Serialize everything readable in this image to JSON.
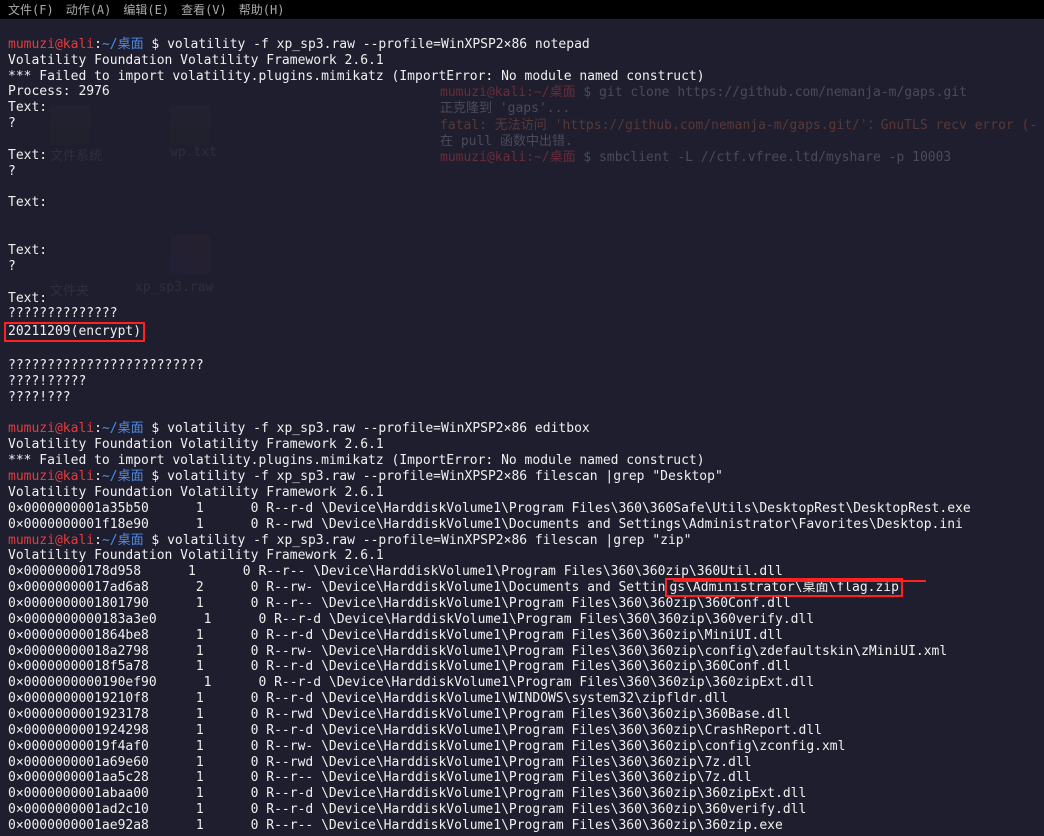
{
  "menu": {
    "items": [
      "文件(F)",
      "动作(A)",
      "编辑(E)",
      "查看(V)",
      "帮助(H)"
    ]
  },
  "background": {
    "lines": [
      {
        "prompt": "mumuzi@kali:~/桌面",
        "cmd": "$ git clone https://github.com/nemanja-m/gaps.git"
      },
      {
        "text": "正克隆到 'gaps'..."
      },
      {
        "text": "fatal: 无法访问 'https://github.com/nemanja-m/gaps.git/'：GnuTLS recv error (-"
      },
      {
        "text": "在 pull 函数中出错."
      },
      {
        "prompt": "mumuzi@kali:~/桌面",
        "cmd": "$ smbclient -L //ctf.vfree.ltd/myshare -p 10003"
      }
    ],
    "icons": [
      {
        "label": "文件系统"
      },
      {
        "label": "wp.txt"
      },
      {
        "label": ""
      },
      {
        "label": "文件夹"
      },
      {
        "label": "xp_sp3.raw"
      }
    ]
  },
  "terminal": {
    "blocks": [
      {
        "prompt": {
          "user": "mumuzi",
          "host": "kali",
          "path": "~/桌面",
          "dollar": "$"
        },
        "command": "volatility -f xp_sp3.raw --profile=WinXPSP2×86 notepad",
        "output": [
          "Volatility Foundation Volatility Framework 2.6.1",
          "*** Failed to import volatility.plugins.mimikatz (ImportError: No module named construct)",
          "Process: 2976",
          "Text:",
          "?",
          "",
          "Text:",
          "?",
          "",
          "Text:",
          "",
          "",
          "Text:",
          "?",
          "",
          "Text:",
          "??????????????",
          "",
          "?????????????????????????",
          "????!?????",
          "????!???",
          ""
        ],
        "highlight": {
          "line_index": 17,
          "text": "20211209(encrypt)"
        }
      },
      {
        "prompt": {
          "user": "mumuzi",
          "host": "kali",
          "path": "~/桌面",
          "dollar": "$"
        },
        "command": "volatility -f xp_sp3.raw --profile=WinXPSP2×86 editbox",
        "output": [
          "Volatility Foundation Volatility Framework 2.6.1",
          "*** Failed to import volatility.plugins.mimikatz (ImportError: No module named construct)"
        ]
      },
      {
        "prompt": {
          "user": "mumuzi",
          "host": "kali",
          "path": "~/桌面",
          "dollar": "$"
        },
        "command": "volatility -f xp_sp3.raw --profile=WinXPSP2×86 filescan |grep \"Desktop\"",
        "output": [
          "Volatility Foundation Volatility Framework 2.6.1",
          "0×0000000001a35b50      1      0 R--r-d \\Device\\HarddiskVolume1\\Program Files\\360\\360Safe\\Utils\\DesktopRest\\DesktopRest.exe",
          "0×0000000001f18e90      1      0 R--rwd \\Device\\HarddiskVolume1\\Documents and Settings\\Administrator\\Favorites\\Desktop.ini"
        ]
      },
      {
        "prompt": {
          "user": "mumuzi",
          "host": "kali",
          "path": "~/桌面",
          "dollar": "$"
        },
        "command": "volatility -f xp_sp3.raw --profile=WinXPSP2×86 filescan |grep \"zip\"",
        "output": [
          "Volatility Foundation Volatility Framework 2.6.1",
          "0×00000000178d958      1      0 R--r-- \\Device\\HarddiskVolume1\\Program Files\\360\\360zip\\360Util.dll",
          "0×00000000017ad6a8      2      0 R--rw- \\Device\\HarddiskVolume1\\Documents and Settings\\Administrator\\桌面\\flag.zip",
          "0×0000000001801790      1      0 R--r-- \\Device\\HarddiskVolume1\\Program Files\\360\\360zip\\360Conf.dll",
          "0×0000000000183a3e0      1      0 R--r-d \\Device\\HarddiskVolume1\\Program Files\\360\\360zip\\360verify.dll",
          "0×0000000001864be8      1      0 R--r-d \\Device\\HarddiskVolume1\\Program Files\\360\\360zip\\MiniUI.dll",
          "0×00000000018a2798      1      0 R--rw- \\Device\\HarddiskVolume1\\Program Files\\360\\360zip\\config\\zdefaultskin\\zMiniUI.xml",
          "0×00000000018f5a78      1      0 R--r-d \\Device\\HarddiskVolume1\\Program Files\\360\\360zip\\360Conf.dll",
          "0×0000000000190ef90      1      0 R--r-d \\Device\\HarddiskVolume1\\Program Files\\360\\360zip\\360zipExt.dll",
          "0×00000000019210f8      1      0 R--r-d \\Device\\HarddiskVolume1\\WINDOWS\\system32\\zipfldr.dll",
          "0×0000000001923178      1      0 R--rwd \\Device\\HarddiskVolume1\\Program Files\\360\\360zip\\360Base.dll",
          "0×0000000001924298      1      0 R--r-d \\Device\\HarddiskVolume1\\Program Files\\360\\360zip\\CrashReport.dll",
          "0×00000000019f4af0      1      0 R--rw- \\Device\\HarddiskVolume1\\Program Files\\360\\360zip\\config\\zconfig.xml",
          "0×0000000001a69e60      1      0 R--rwd \\Device\\HarddiskVolume1\\Program Files\\360\\360zip\\7z.dll",
          "0×0000000001aa5c28      1      0 R--r-- \\Device\\HarddiskVolume1\\Program Files\\360\\360zip\\7z.dll",
          "0×0000000001abaa00      1      0 R--r-d \\Device\\HarddiskVolume1\\Program Files\\360\\360zip\\360zipExt.dll",
          "0×0000000001ad2c10      1      0 R--r-d \\Device\\HarddiskVolume1\\Program Files\\360\\360zip\\360verify.dll",
          "0×0000000001ae92a8      1      0 R--r-- \\Device\\HarddiskVolume1\\Program Files\\360\\360zip\\360zip.exe"
        ],
        "highlight2": {
          "row": 2,
          "start_text": "gs\\Administrator\\桌面\\flag.zip"
        }
      }
    ]
  }
}
